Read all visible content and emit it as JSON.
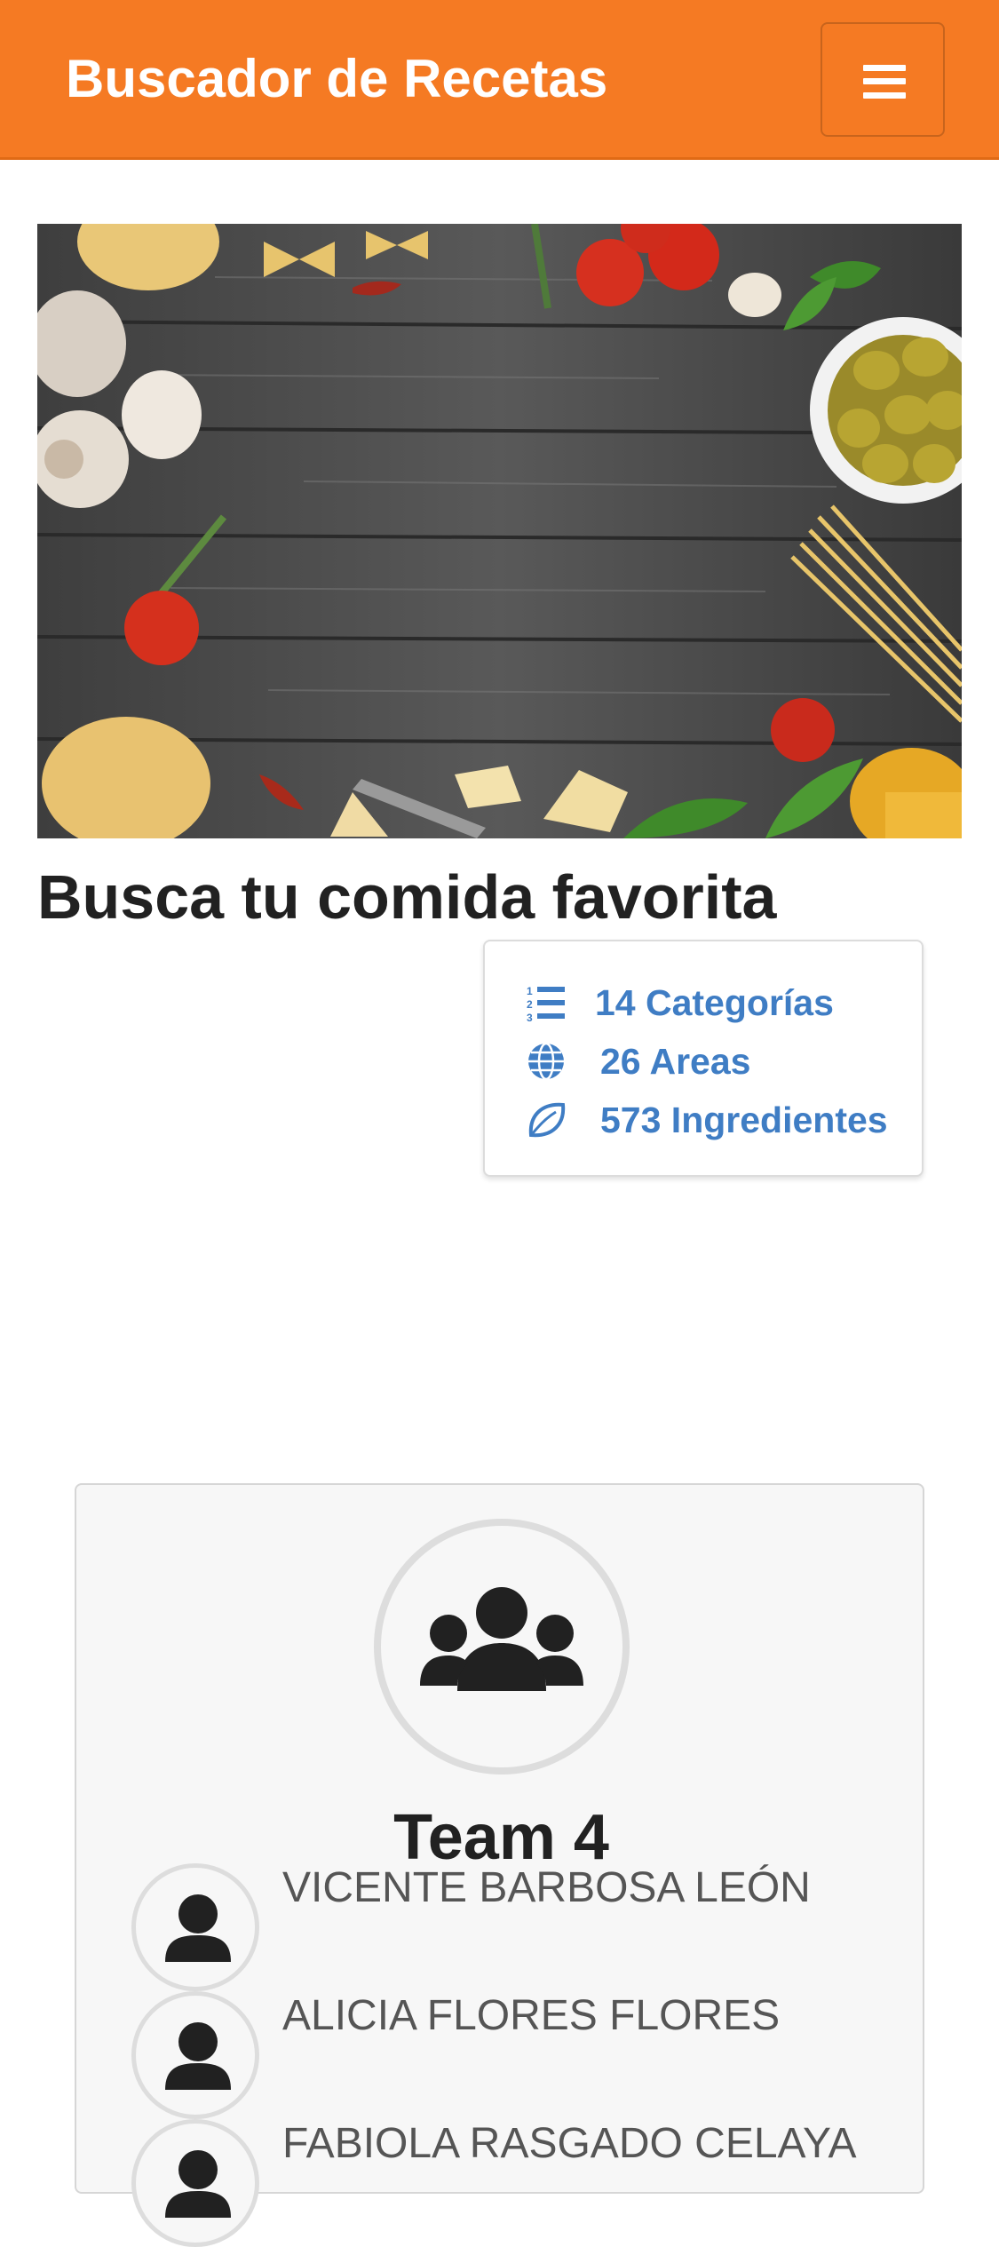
{
  "navbar": {
    "brand": "Buscador de Recetas",
    "toggle_icon": "hamburger-menu-icon",
    "brand_color": "#f57a23"
  },
  "hero": {
    "image": "food-ingredients-on-dark-wood-photo"
  },
  "headline": "Busca tu comida favorita",
  "stats": {
    "accent_color": "#3f7dc4",
    "items": [
      {
        "icon": "numbered-list-icon",
        "label": "14 Categorías"
      },
      {
        "icon": "globe-icon",
        "label": "26 Areas"
      },
      {
        "icon": "leaf-icon",
        "label": "573 Ingredientes"
      }
    ]
  },
  "team": {
    "icon": "users-group-icon",
    "title": "Team 4",
    "members": [
      {
        "icon": "user-icon",
        "name": "VICENTE BARBOSA LEÓN"
      },
      {
        "icon": "user-icon",
        "name": "ALICIA FLORES FLORES"
      },
      {
        "icon": "user-icon",
        "name": "FABIOLA RASGADO CELAYA"
      }
    ]
  }
}
